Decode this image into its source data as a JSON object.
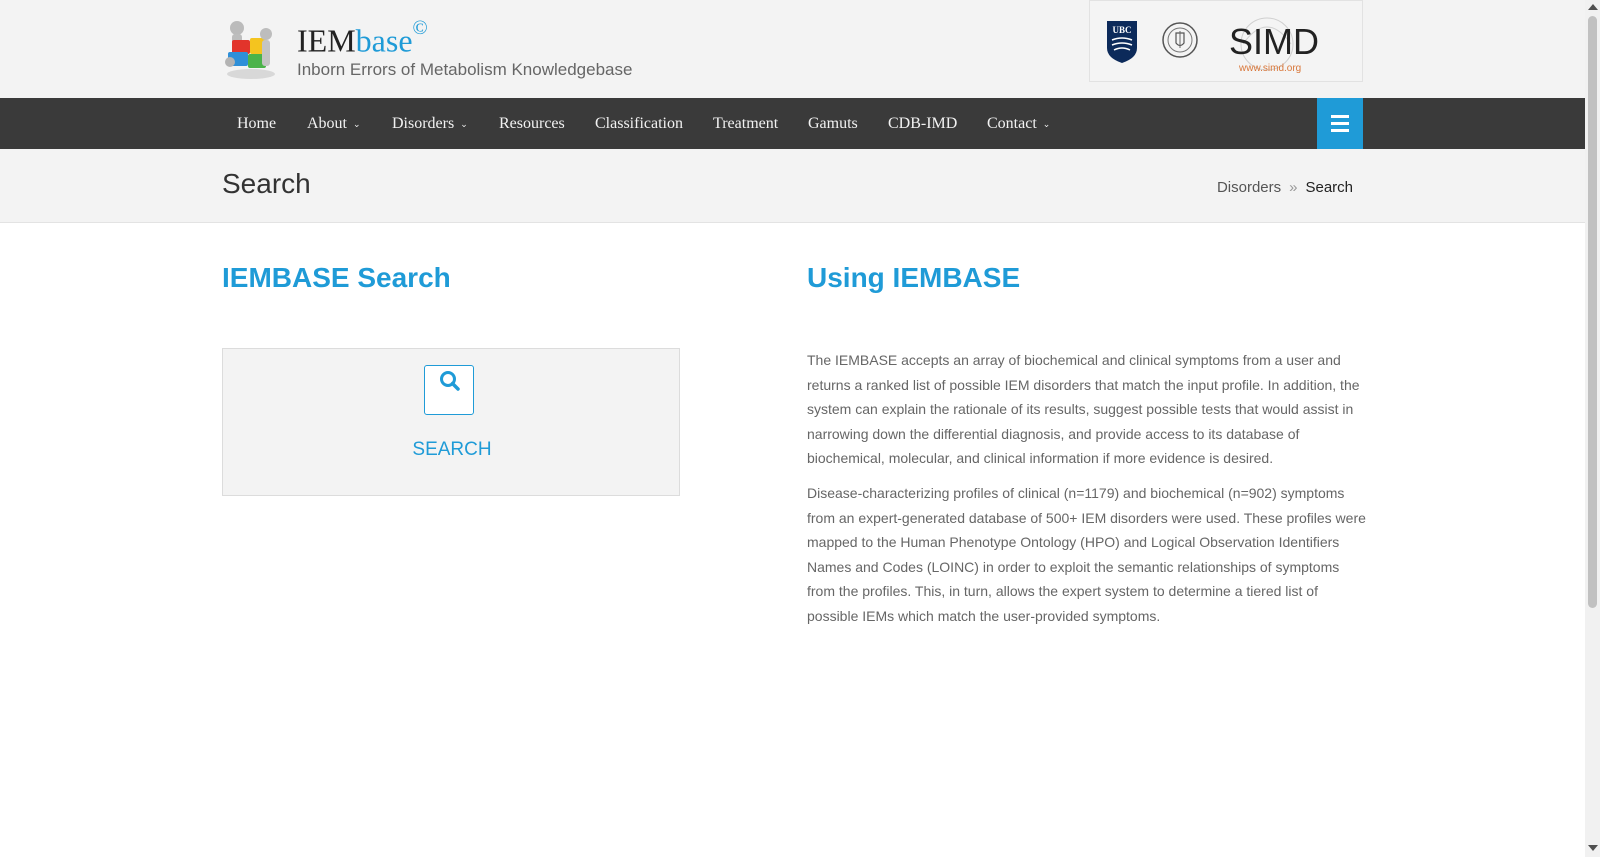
{
  "header": {
    "brand_main": "IEM",
    "brand_accent": "base",
    "brand_mark": "©",
    "tagline": "Inborn Errors of Metabolism Knowledgebase",
    "partners": {
      "ubc_logo": "UBC",
      "simd_logo": "SIMD",
      "simd_url": "www.simd.org"
    }
  },
  "nav": {
    "items": [
      {
        "label": "Home"
      },
      {
        "label": "About"
      },
      {
        "label": "Disorders"
      },
      {
        "label": "Resources"
      },
      {
        "label": "Classification"
      },
      {
        "label": "Treatment"
      },
      {
        "label": "Gamuts"
      },
      {
        "label": "CDB-IMD"
      },
      {
        "label": "Contact"
      }
    ],
    "caret": "⌄",
    "menu_icon": "hamburger-icon"
  },
  "titlebar": {
    "title": "Search",
    "breadcrumb": [
      "Disorders",
      "Search"
    ],
    "separator": "»"
  },
  "search_panel": {
    "heading": "IEMBASE Search",
    "button_label": "SEARCH",
    "icon": "search-icon"
  },
  "info_panel": {
    "heading": "Using IEMBASE",
    "paragraphs": [
      "The IEMBASE accepts an array of biochemical and clinical symptoms from a user and returns a ranked list of possible IEM disorders that match the input profile. In addition, the system can explain the rationale of its results, suggest possible tests that would assist in narrowing down the differential diagnosis, and provide access to its database of biochemical, molecular, and clinical information if more evidence is desired.",
      "Disease-characterizing profiles of clinical (n=1179) and biochemical (n=902) symptoms from an expert-generated database of 500+ IEM disorders were used. These profiles were mapped to the Human Phenotype Ontology (HPO) and Logical Observation Identifiers Names and Codes (LOINC) in order to exploit the semantic relationships of symptoms from the profiles. This, in turn, allows the expert system to determine a tiered list of possible IEMs which match the user-provided symptoms."
    ]
  },
  "colors": {
    "accent": "#1f9bd7",
    "nav_bg": "#3a3a3a",
    "header_bg": "#f3f3f3"
  }
}
